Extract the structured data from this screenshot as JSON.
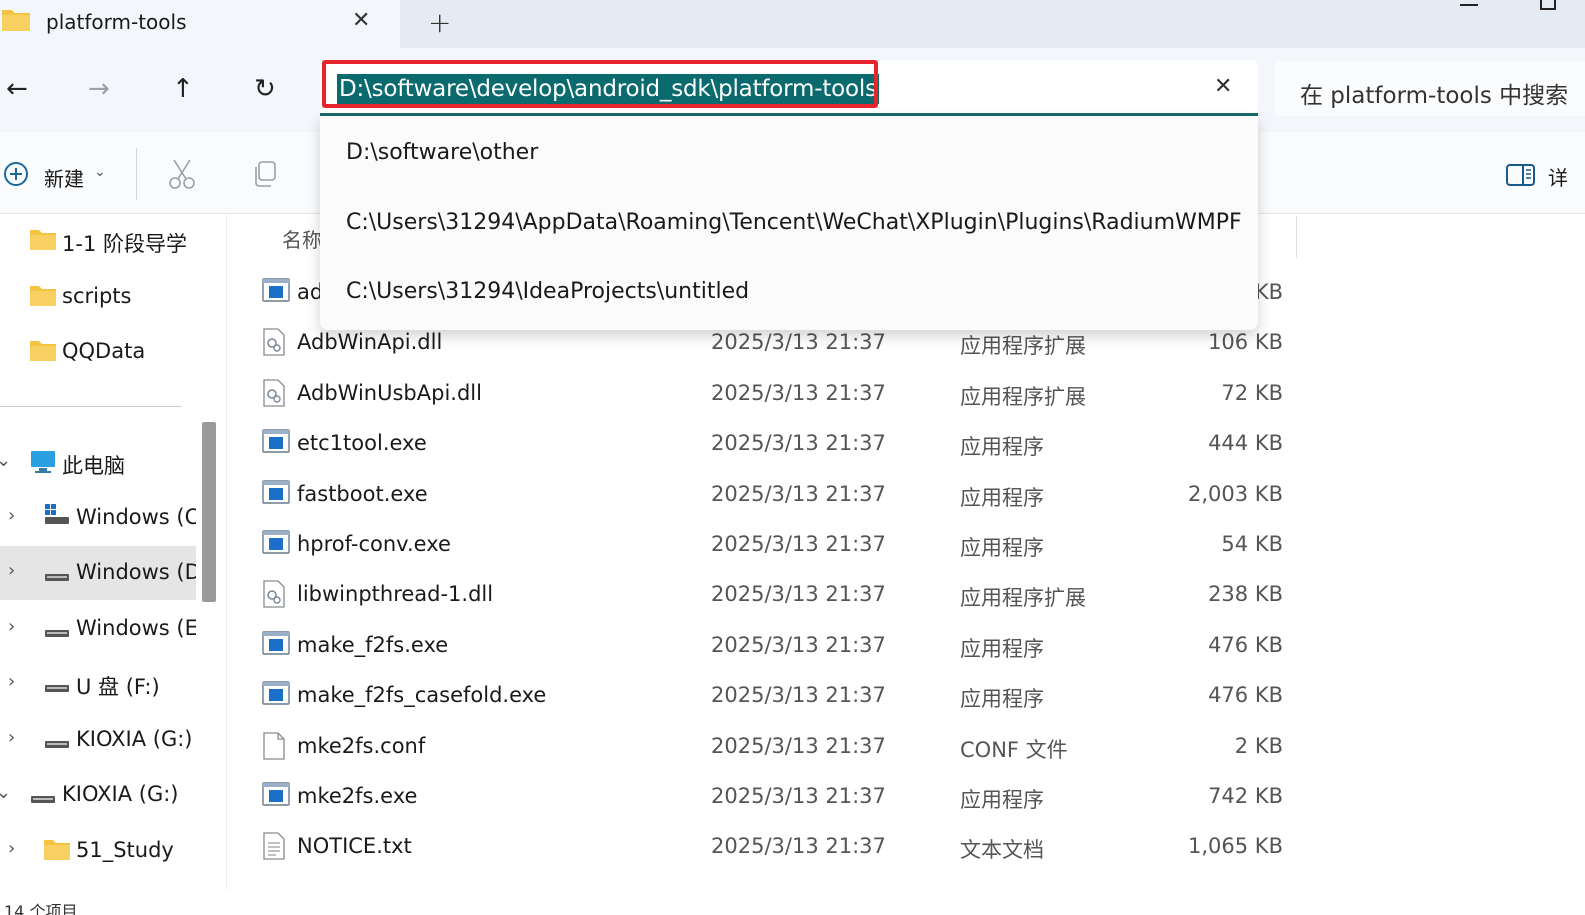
{
  "tab": {
    "title": "platform-tools",
    "close": "✕",
    "new": "+"
  },
  "nav": {
    "back": "←",
    "forward": "→",
    "up": "↑",
    "refresh": "↻"
  },
  "address": {
    "path": "D:\\software\\develop\\android_sdk\\platform-tools",
    "clear": "✕"
  },
  "search": {
    "placeholder": "在 platform-tools 中搜索"
  },
  "commandbar": {
    "new_label": "新建",
    "new_chevron": "⌄",
    "details_label": "详"
  },
  "dropdown": {
    "items": [
      "D:\\software\\other",
      "C:\\Users\\31294\\AppData\\Roaming\\Tencent\\WeChat\\XPlugin\\Plugins\\RadiumWMPF",
      "C:\\Users\\31294\\IdeaProjects\\untitled"
    ]
  },
  "sidebar": {
    "items": [
      {
        "label": "1-1 阶段导学",
        "icon": "folder-icon"
      },
      {
        "label": "scripts",
        "icon": "folder-icon"
      },
      {
        "label": "QQData",
        "icon": "folder-icon"
      },
      {
        "label": "此电脑",
        "icon": "computer-icon",
        "chevron": "⌄"
      },
      {
        "label": "Windows (C",
        "icon": "windows-drive-icon",
        "chevron": "›"
      },
      {
        "label": "Windows (D",
        "icon": "drive-icon",
        "chevron": "›"
      },
      {
        "label": "Windows (E",
        "icon": "drive-icon",
        "chevron": "›"
      },
      {
        "label": "U 盘 (F:)",
        "icon": "drive-icon",
        "chevron": "›"
      },
      {
        "label": "KIOXIA (G:)",
        "icon": "drive-icon",
        "chevron": "›"
      },
      {
        "label": "KIOXIA (G:)",
        "icon": "drive-icon",
        "chevron": "⌄"
      },
      {
        "label": "51_Study",
        "icon": "folder-icon",
        "chevron": "›"
      }
    ]
  },
  "filelist": {
    "header_name": "名称",
    "rows": [
      {
        "name": "ad",
        "date": "",
        "type": "",
        "size": "KB",
        "icon": "exe-icon"
      },
      {
        "name": "AdbWinApi.dll",
        "date": "2025/3/13 21:37",
        "type": "应用程序扩展",
        "size": "106 KB",
        "icon": "dll-icon"
      },
      {
        "name": "AdbWinUsbApi.dll",
        "date": "2025/3/13 21:37",
        "type": "应用程序扩展",
        "size": "72 KB",
        "icon": "dll-icon"
      },
      {
        "name": "etc1tool.exe",
        "date": "2025/3/13 21:37",
        "type": "应用程序",
        "size": "444 KB",
        "icon": "exe-icon"
      },
      {
        "name": "fastboot.exe",
        "date": "2025/3/13 21:37",
        "type": "应用程序",
        "size": "2,003 KB",
        "icon": "exe-icon"
      },
      {
        "name": "hprof-conv.exe",
        "date": "2025/3/13 21:37",
        "type": "应用程序",
        "size": "54 KB",
        "icon": "exe-icon"
      },
      {
        "name": "libwinpthread-1.dll",
        "date": "2025/3/13 21:37",
        "type": "应用程序扩展",
        "size": "238 KB",
        "icon": "dll-icon"
      },
      {
        "name": "make_f2fs.exe",
        "date": "2025/3/13 21:37",
        "type": "应用程序",
        "size": "476 KB",
        "icon": "exe-icon"
      },
      {
        "name": "make_f2fs_casefold.exe",
        "date": "2025/3/13 21:37",
        "type": "应用程序",
        "size": "476 KB",
        "icon": "exe-icon"
      },
      {
        "name": "mke2fs.conf",
        "date": "2025/3/13 21:37",
        "type": "CONF 文件",
        "size": "2 KB",
        "icon": "file-icon"
      },
      {
        "name": "mke2fs.exe",
        "date": "2025/3/13 21:37",
        "type": "应用程序",
        "size": "742 KB",
        "icon": "exe-icon"
      },
      {
        "name": "NOTICE.txt",
        "date": "2025/3/13 21:37",
        "type": "文本文档",
        "size": "1,065 KB",
        "icon": "text-icon"
      }
    ]
  },
  "status": {
    "text": "14 个项目"
  },
  "colors": {
    "address_highlight": "#e8242c",
    "selection": "#0a6a6e",
    "folder": "#f5c342"
  }
}
